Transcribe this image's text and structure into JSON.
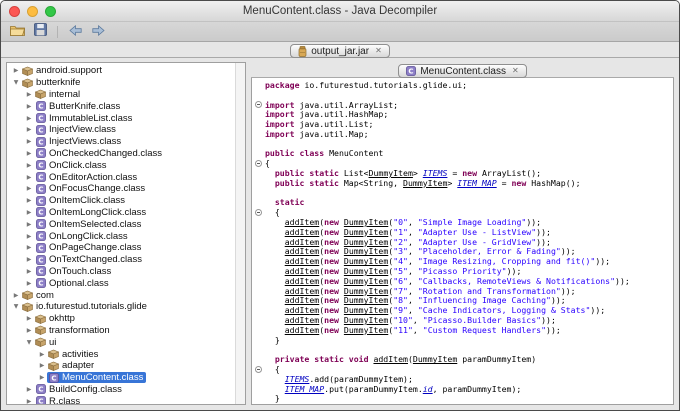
{
  "window": {
    "title": "MenuContent.class - Java Decompiler"
  },
  "toolbar": {
    "buttons": [
      {
        "name": "open-file"
      },
      {
        "name": "save-all-sources"
      },
      {
        "name": "back"
      },
      {
        "name": "forward"
      }
    ]
  },
  "icons": {
    "close": "✕",
    "collapsed": "▶",
    "expanded": "▼"
  },
  "tabs": {
    "outer": {
      "label": "output_jar.jar"
    },
    "inner": {
      "label": "MenuContent.class"
    }
  },
  "colors": {
    "selection": "#3875d7",
    "keyword": "#7f0055",
    "string": "#2a00ff",
    "field_link": "#0000c0"
  },
  "tree": {
    "items": [
      {
        "label": "android.support",
        "icon": "package",
        "depth": 0,
        "arrow": "collapsed"
      },
      {
        "label": "butterknife",
        "icon": "package",
        "depth": 0,
        "arrow": "expanded"
      },
      {
        "label": "internal",
        "icon": "package",
        "depth": 1,
        "arrow": "collapsed"
      },
      {
        "label": "ButterKnife.class",
        "icon": "class",
        "depth": 1,
        "arrow": "collapsed"
      },
      {
        "label": "ImmutableList.class",
        "icon": "class",
        "depth": 1,
        "arrow": "collapsed"
      },
      {
        "label": "InjectView.class",
        "icon": "class",
        "depth": 1,
        "arrow": "collapsed"
      },
      {
        "label": "InjectViews.class",
        "icon": "class",
        "depth": 1,
        "arrow": "collapsed"
      },
      {
        "label": "OnCheckedChanged.class",
        "icon": "class",
        "depth": 1,
        "arrow": "collapsed"
      },
      {
        "label": "OnClick.class",
        "icon": "class",
        "depth": 1,
        "arrow": "collapsed"
      },
      {
        "label": "OnEditorAction.class",
        "icon": "class",
        "depth": 1,
        "arrow": "collapsed"
      },
      {
        "label": "OnFocusChange.class",
        "icon": "class",
        "depth": 1,
        "arrow": "collapsed"
      },
      {
        "label": "OnItemClick.class",
        "icon": "class",
        "depth": 1,
        "arrow": "collapsed"
      },
      {
        "label": "OnItemLongClick.class",
        "icon": "class",
        "depth": 1,
        "arrow": "collapsed"
      },
      {
        "label": "OnItemSelected.class",
        "icon": "class",
        "depth": 1,
        "arrow": "collapsed"
      },
      {
        "label": "OnLongClick.class",
        "icon": "class",
        "depth": 1,
        "arrow": "collapsed"
      },
      {
        "label": "OnPageChange.class",
        "icon": "class",
        "depth": 1,
        "arrow": "collapsed"
      },
      {
        "label": "OnTextChanged.class",
        "icon": "class",
        "depth": 1,
        "arrow": "collapsed"
      },
      {
        "label": "OnTouch.class",
        "icon": "class",
        "depth": 1,
        "arrow": "collapsed"
      },
      {
        "label": "Optional.class",
        "icon": "class",
        "depth": 1,
        "arrow": "collapsed"
      },
      {
        "label": "com",
        "icon": "package",
        "depth": 0,
        "arrow": "collapsed"
      },
      {
        "label": "io.futurestud.tutorials.glide",
        "icon": "package",
        "depth": 0,
        "arrow": "expanded"
      },
      {
        "label": "okhttp",
        "icon": "package",
        "depth": 1,
        "arrow": "collapsed"
      },
      {
        "label": "transformation",
        "icon": "package",
        "depth": 1,
        "arrow": "collapsed"
      },
      {
        "label": "ui",
        "icon": "package",
        "depth": 1,
        "arrow": "expanded"
      },
      {
        "label": "activities",
        "icon": "package",
        "depth": 2,
        "arrow": "collapsed"
      },
      {
        "label": "adapter",
        "icon": "package",
        "depth": 2,
        "arrow": "collapsed"
      },
      {
        "label": "MenuContent.class",
        "icon": "class",
        "depth": 2,
        "arrow": "collapsed",
        "selected": true
      },
      {
        "label": "BuildConfig.class",
        "icon": "class",
        "depth": 1,
        "arrow": "collapsed"
      },
      {
        "label": "R.class",
        "icon": "class",
        "depth": 1,
        "arrow": "collapsed"
      }
    ]
  },
  "code": {
    "lines": [
      {
        "fold": false,
        "segs": [
          [
            "kw",
            "package "
          ],
          [
            "pl",
            "io.futurestud.tutorials.glide.ui;"
          ]
        ]
      },
      {
        "fold": false,
        "segs": []
      },
      {
        "fold": true,
        "segs": [
          [
            "kw",
            "import "
          ],
          [
            "pl",
            "java.util.ArrayList;"
          ]
        ]
      },
      {
        "fold": false,
        "segs": [
          [
            "kw",
            "import "
          ],
          [
            "pl",
            "java.util.HashMap;"
          ]
        ]
      },
      {
        "fold": false,
        "segs": [
          [
            "kw",
            "import "
          ],
          [
            "pl",
            "java.util.List;"
          ]
        ]
      },
      {
        "fold": false,
        "segs": [
          [
            "kw",
            "import "
          ],
          [
            "pl",
            "java.util.Map;"
          ]
        ]
      },
      {
        "fold": false,
        "segs": []
      },
      {
        "fold": false,
        "segs": [
          [
            "kw",
            "public class "
          ],
          [
            "pl",
            "MenuContent"
          ]
        ]
      },
      {
        "fold": true,
        "segs": [
          [
            "pl",
            "{"
          ]
        ]
      },
      {
        "fold": false,
        "segs": [
          [
            "pl",
            "  "
          ],
          [
            "kw",
            "public static "
          ],
          [
            "pl",
            "List<"
          ],
          [
            "lnk",
            "DummyItem"
          ],
          [
            "pl",
            "> "
          ],
          [
            "flk",
            "ITEMS"
          ],
          [
            "pl",
            " = "
          ],
          [
            "kw",
            "new "
          ],
          [
            "pl",
            "ArrayList();"
          ]
        ]
      },
      {
        "fold": false,
        "segs": [
          [
            "pl",
            "  "
          ],
          [
            "kw",
            "public static "
          ],
          [
            "pl",
            "Map<String, "
          ],
          [
            "lnk",
            "DummyItem"
          ],
          [
            "pl",
            "> "
          ],
          [
            "flk",
            "ITEM_MAP"
          ],
          [
            "pl",
            " = "
          ],
          [
            "kw",
            "new "
          ],
          [
            "pl",
            "HashMap();"
          ]
        ]
      },
      {
        "fold": false,
        "segs": []
      },
      {
        "fold": false,
        "segs": [
          [
            "pl",
            "  "
          ],
          [
            "kw",
            "static"
          ]
        ]
      },
      {
        "fold": true,
        "segs": [
          [
            "pl",
            "  {"
          ]
        ]
      },
      {
        "fold": false,
        "segs": [
          [
            "pl",
            "    "
          ],
          [
            "lnk",
            "addItem"
          ],
          [
            "pl",
            "("
          ],
          [
            "kw",
            "new "
          ],
          [
            "lnk",
            "DummyItem"
          ],
          [
            "pl",
            "("
          ],
          [
            "str",
            "\"0\""
          ],
          [
            "pl",
            ", "
          ],
          [
            "str",
            "\"Simple Image Loading\""
          ],
          [
            "pl",
            "));"
          ]
        ]
      },
      {
        "fold": false,
        "segs": [
          [
            "pl",
            "    "
          ],
          [
            "lnk",
            "addItem"
          ],
          [
            "pl",
            "("
          ],
          [
            "kw",
            "new "
          ],
          [
            "lnk",
            "DummyItem"
          ],
          [
            "pl",
            "("
          ],
          [
            "str",
            "\"1\""
          ],
          [
            "pl",
            ", "
          ],
          [
            "str",
            "\"Adapter Use - ListView\""
          ],
          [
            "pl",
            "));"
          ]
        ]
      },
      {
        "fold": false,
        "segs": [
          [
            "pl",
            "    "
          ],
          [
            "lnk",
            "addItem"
          ],
          [
            "pl",
            "("
          ],
          [
            "kw",
            "new "
          ],
          [
            "lnk",
            "DummyItem"
          ],
          [
            "pl",
            "("
          ],
          [
            "str",
            "\"2\""
          ],
          [
            "pl",
            ", "
          ],
          [
            "str",
            "\"Adapter Use - GridView\""
          ],
          [
            "pl",
            "));"
          ]
        ]
      },
      {
        "fold": false,
        "segs": [
          [
            "pl",
            "    "
          ],
          [
            "lnk",
            "addItem"
          ],
          [
            "pl",
            "("
          ],
          [
            "kw",
            "new "
          ],
          [
            "lnk",
            "DummyItem"
          ],
          [
            "pl",
            "("
          ],
          [
            "str",
            "\"3\""
          ],
          [
            "pl",
            ", "
          ],
          [
            "str",
            "\"Placeholder, Error & Fading\""
          ],
          [
            "pl",
            "));"
          ]
        ]
      },
      {
        "fold": false,
        "segs": [
          [
            "pl",
            "    "
          ],
          [
            "lnk",
            "addItem"
          ],
          [
            "pl",
            "("
          ],
          [
            "kw",
            "new "
          ],
          [
            "lnk",
            "DummyItem"
          ],
          [
            "pl",
            "("
          ],
          [
            "str",
            "\"4\""
          ],
          [
            "pl",
            ", "
          ],
          [
            "str",
            "\"Image Resizing, Cropping and fit()\""
          ],
          [
            "pl",
            "));"
          ]
        ]
      },
      {
        "fold": false,
        "segs": [
          [
            "pl",
            "    "
          ],
          [
            "lnk",
            "addItem"
          ],
          [
            "pl",
            "("
          ],
          [
            "kw",
            "new "
          ],
          [
            "lnk",
            "DummyItem"
          ],
          [
            "pl",
            "("
          ],
          [
            "str",
            "\"5\""
          ],
          [
            "pl",
            ", "
          ],
          [
            "str",
            "\"Picasso Priority\""
          ],
          [
            "pl",
            "));"
          ]
        ]
      },
      {
        "fold": false,
        "segs": [
          [
            "pl",
            "    "
          ],
          [
            "lnk",
            "addItem"
          ],
          [
            "pl",
            "("
          ],
          [
            "kw",
            "new "
          ],
          [
            "lnk",
            "DummyItem"
          ],
          [
            "pl",
            "("
          ],
          [
            "str",
            "\"6\""
          ],
          [
            "pl",
            ", "
          ],
          [
            "str",
            "\"Callbacks, RemoteViews & Notifications\""
          ],
          [
            "pl",
            "));"
          ]
        ]
      },
      {
        "fold": false,
        "segs": [
          [
            "pl",
            "    "
          ],
          [
            "lnk",
            "addItem"
          ],
          [
            "pl",
            "("
          ],
          [
            "kw",
            "new "
          ],
          [
            "lnk",
            "DummyItem"
          ],
          [
            "pl",
            "("
          ],
          [
            "str",
            "\"7\""
          ],
          [
            "pl",
            ", "
          ],
          [
            "str",
            "\"Rotation and Transformation\""
          ],
          [
            "pl",
            "));"
          ]
        ]
      },
      {
        "fold": false,
        "segs": [
          [
            "pl",
            "    "
          ],
          [
            "lnk",
            "addItem"
          ],
          [
            "pl",
            "("
          ],
          [
            "kw",
            "new "
          ],
          [
            "lnk",
            "DummyItem"
          ],
          [
            "pl",
            "("
          ],
          [
            "str",
            "\"8\""
          ],
          [
            "pl",
            ", "
          ],
          [
            "str",
            "\"Influencing Image Caching\""
          ],
          [
            "pl",
            "));"
          ]
        ]
      },
      {
        "fold": false,
        "segs": [
          [
            "pl",
            "    "
          ],
          [
            "lnk",
            "addItem"
          ],
          [
            "pl",
            "("
          ],
          [
            "kw",
            "new "
          ],
          [
            "lnk",
            "DummyItem"
          ],
          [
            "pl",
            "("
          ],
          [
            "str",
            "\"9\""
          ],
          [
            "pl",
            ", "
          ],
          [
            "str",
            "\"Cache Indicators, Logging & Stats\""
          ],
          [
            "pl",
            "));"
          ]
        ]
      },
      {
        "fold": false,
        "segs": [
          [
            "pl",
            "    "
          ],
          [
            "lnk",
            "addItem"
          ],
          [
            "pl",
            "("
          ],
          [
            "kw",
            "new "
          ],
          [
            "lnk",
            "DummyItem"
          ],
          [
            "pl",
            "("
          ],
          [
            "str",
            "\"10\""
          ],
          [
            "pl",
            ", "
          ],
          [
            "str",
            "\"Picasso.Builder Basics\""
          ],
          [
            "pl",
            "));"
          ]
        ]
      },
      {
        "fold": false,
        "segs": [
          [
            "pl",
            "    "
          ],
          [
            "lnk",
            "addItem"
          ],
          [
            "pl",
            "("
          ],
          [
            "kw",
            "new "
          ],
          [
            "lnk",
            "DummyItem"
          ],
          [
            "pl",
            "("
          ],
          [
            "str",
            "\"11\""
          ],
          [
            "pl",
            ", "
          ],
          [
            "str",
            "\"Custom Request Handlers\""
          ],
          [
            "pl",
            "));"
          ]
        ]
      },
      {
        "fold": false,
        "segs": [
          [
            "pl",
            "  }"
          ]
        ]
      },
      {
        "fold": false,
        "segs": []
      },
      {
        "fold": false,
        "segs": [
          [
            "pl",
            "  "
          ],
          [
            "kw",
            "private static void "
          ],
          [
            "lnk",
            "addItem"
          ],
          [
            "pl",
            "("
          ],
          [
            "lnk",
            "DummyItem"
          ],
          [
            "pl",
            " paramDummyItem)"
          ]
        ]
      },
      {
        "fold": true,
        "segs": [
          [
            "pl",
            "  {"
          ]
        ]
      },
      {
        "fold": false,
        "segs": [
          [
            "pl",
            "    "
          ],
          [
            "flk",
            "ITEMS"
          ],
          [
            "pl",
            ".add(paramDummyItem);"
          ]
        ]
      },
      {
        "fold": false,
        "segs": [
          [
            "pl",
            "    "
          ],
          [
            "flk",
            "ITEM_MAP"
          ],
          [
            "pl",
            ".put(paramDummyItem."
          ],
          [
            "flk",
            "id"
          ],
          [
            "pl",
            ", paramDummyItem);"
          ]
        ]
      },
      {
        "fold": false,
        "segs": [
          [
            "pl",
            "  }"
          ]
        ]
      }
    ]
  }
}
